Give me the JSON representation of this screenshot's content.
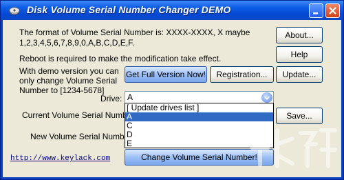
{
  "window": {
    "title": "Disk Volume Serial Number Changer DEMO"
  },
  "info": {
    "format_line1": "The format of Volume Serial Number is: XXXX-XXXX, X maybe",
    "format_line2": "1,2,3,4,5,6,7,8,9,0,A,B,C,D,E,F.",
    "reboot_note": "Reboot is required to make the modification take effect.",
    "demo_line1": "With demo version you can",
    "demo_line2": "only change Volume Serial",
    "demo_line3": "Number to [1234-5678]"
  },
  "buttons": {
    "about": "About...",
    "help": "Help",
    "get_full": "Get Full Version Now!",
    "registration": "Registration...",
    "update": "Update...",
    "save": "Save...",
    "change": "Change Volume Serial Number!"
  },
  "drive": {
    "label": "Drive:",
    "selected": "A",
    "options": [
      "[ Update drives list ]",
      "A",
      "C",
      "D",
      "E"
    ],
    "selected_index": 1
  },
  "labels": {
    "current_serial": "Current Volume Serial Number:",
    "new_serial": "New Volume Serial Number:"
  },
  "link": "http://www.keylack.com"
}
